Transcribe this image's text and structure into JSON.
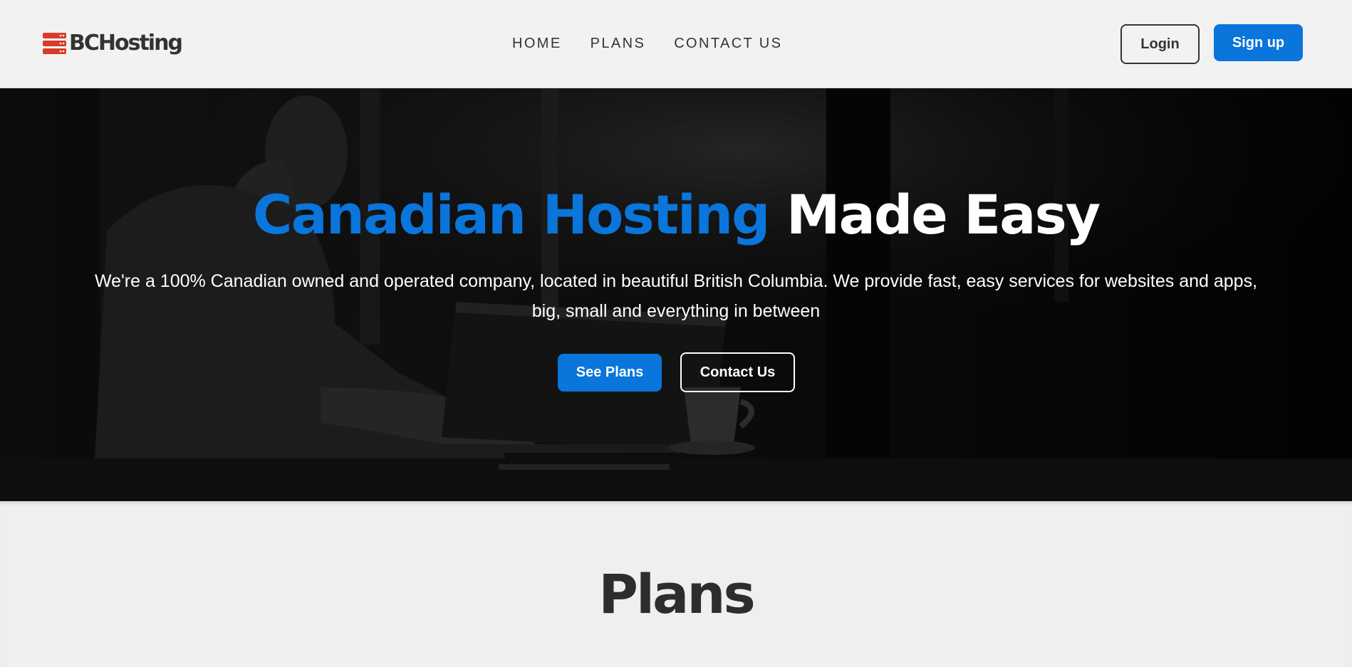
{
  "brand": {
    "name": "BCHosting",
    "logo_icon": "server-stack-icon",
    "logo_color": "#d83b2b"
  },
  "nav": {
    "items": [
      {
        "label": "HOME"
      },
      {
        "label": "PLANS"
      },
      {
        "label": "CONTACT US"
      }
    ]
  },
  "auth": {
    "login_label": "Login",
    "signup_label": "Sign up"
  },
  "hero": {
    "title_accent": "Canadian Hosting",
    "title_rest": "Made Easy",
    "subtitle": "We're a 100% Canadian owned and operated company, located in beautiful British Columbia. We provide fast, easy services for websites and apps, big, small and everything in between",
    "primary_cta": "See Plans",
    "secondary_cta": "Contact Us",
    "background_image": "person-working-on-laptop-in-cafe"
  },
  "plans": {
    "heading": "Plans"
  },
  "colors": {
    "accent": "#0a75db",
    "text_dark": "#333333",
    "header_bg": "#f2f2f2",
    "page_bg": "#efefef"
  }
}
